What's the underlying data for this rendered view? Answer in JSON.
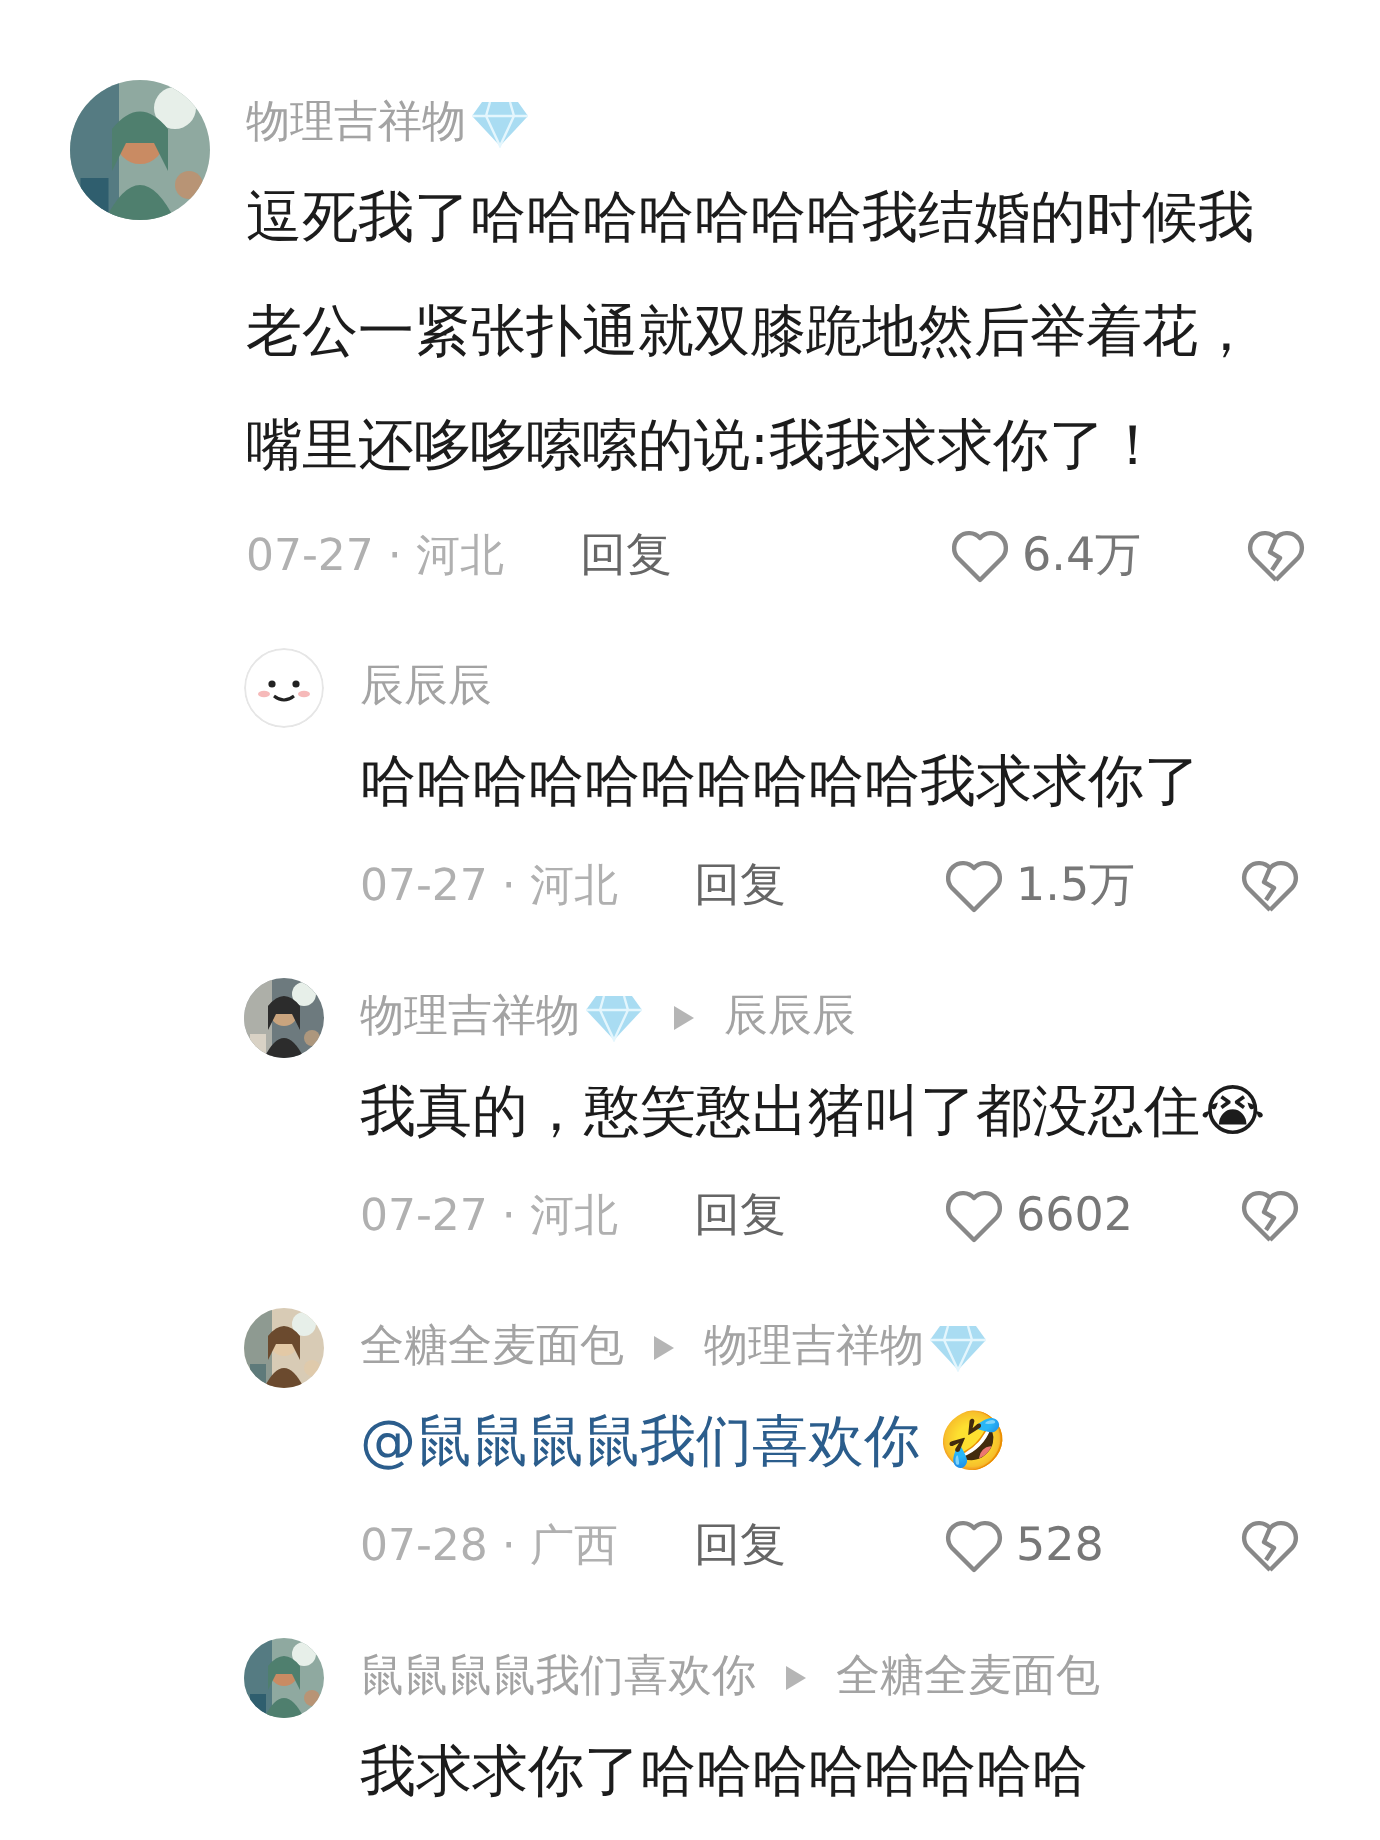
{
  "comments": [
    {
      "author": "物理吉祥物",
      "author_badge": true,
      "mention": false,
      "text": "逗死我了哈哈哈哈哈哈哈我结婚的时候我老公一紧张扑通就双膝跪地然后举着花，嘴里还哆哆嗦嗦的说:我我求求你了！",
      "meta": "07-27 · 河北",
      "reply_label": "回复",
      "likes": "6.4万",
      "replies": [
        {
          "avatar": {
            "kind": "smiley"
          },
          "author": "辰辰辰",
          "author_badge": false,
          "mention": false,
          "text": "哈哈哈哈哈哈哈哈哈哈我求求你了",
          "meta": "07-27 · 河北",
          "reply_label": "回复",
          "likes": "1.5万"
        },
        {
          "author": "物理吉祥物",
          "author_badge": true,
          "reply_to": "辰辰辰",
          "reply_to_badge": false,
          "mention": false,
          "text": "我真的，憨笑憨出猪叫了都没忍住😭",
          "meta": "07-27 · 河北",
          "reply_label": "回复",
          "likes": "6602"
        },
        {
          "author": "全糖全麦面包",
          "author_badge": false,
          "reply_to": "物理吉祥物",
          "reply_to_badge": true,
          "mention": true,
          "text": "@鼠鼠鼠鼠我们喜欢你 🤣",
          "meta": "07-28 · 广西",
          "reply_label": "回复",
          "likes": "528"
        },
        {
          "author": "鼠鼠鼠鼠我们喜欢你",
          "author_badge": false,
          "reply_to": "全糖全麦面包",
          "reply_to_badge": false,
          "mention": false,
          "text": "我求求你了哈哈哈哈哈哈哈哈"
        }
      ]
    }
  ]
}
